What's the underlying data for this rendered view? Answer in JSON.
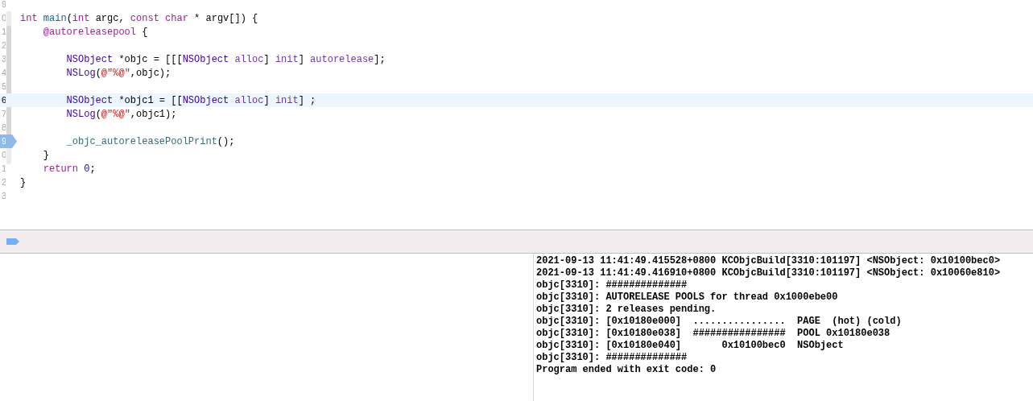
{
  "editor": {
    "lines": [
      {
        "number": "9",
        "current": false,
        "breakpoint": false
      },
      {
        "number": "0",
        "current": false,
        "breakpoint": false,
        "tokens": [
          {
            "kind": "keyword",
            "text": "int "
          },
          {
            "kind": "function",
            "text": "main"
          },
          {
            "kind": "plain",
            "text": "("
          },
          {
            "kind": "keyword",
            "text": "int"
          },
          {
            "kind": "plain",
            "text": " argc, "
          },
          {
            "kind": "keyword",
            "text": "const char"
          },
          {
            "kind": "plain",
            "text": " * argv[]) {"
          }
        ],
        "children": [
          {
            "number": "1",
            "current": false,
            "breakpoint": false,
            "tokens": [
              {
                "kind": "keyword",
                "text": "@autoreleasepool"
              },
              {
                "kind": "plain",
                "text": " {"
              }
            ],
            "children": [
              {
                "number": "2",
                "current": false,
                "breakpoint": false
              },
              {
                "number": "3",
                "current": false,
                "breakpoint": false,
                "tokens": [
                  {
                    "kind": "class",
                    "text": "NSObject"
                  },
                  {
                    "kind": "plain",
                    "text": " *objc = [[["
                  },
                  {
                    "kind": "class",
                    "text": "NSObject"
                  },
                  {
                    "kind": "method",
                    "text": " alloc"
                  },
                  {
                    "kind": "plain",
                    "text": "] "
                  },
                  {
                    "kind": "method",
                    "text": "init"
                  },
                  {
                    "kind": "plain",
                    "text": "] "
                  },
                  {
                    "kind": "method",
                    "text": "autorelease"
                  },
                  {
                    "kind": "plain",
                    "text": "];"
                  }
                ]
              },
              {
                "number": "4",
                "current": false,
                "breakpoint": false,
                "tokens": [
                  {
                    "kind": "class",
                    "text": "NSLog"
                  },
                  {
                    "kind": "plain",
                    "text": "("
                  },
                  {
                    "kind": "string",
                    "text": "@\"%@\""
                  },
                  {
                    "kind": "plain",
                    "text": ",objc);"
                  }
                ]
              },
              {
                "number": "5",
                "current": false,
                "breakpoint": false
              },
              {
                "number": "6",
                "current": true,
                "breakpoint": false,
                "tokens": [
                  {
                    "kind": "class",
                    "text": "NSObject"
                  },
                  {
                    "kind": "plain",
                    "text": " *objc1 = [["
                  },
                  {
                    "kind": "class",
                    "text": "NSObject"
                  },
                  {
                    "kind": "method",
                    "text": " alloc"
                  },
                  {
                    "kind": "plain",
                    "text": "] "
                  },
                  {
                    "kind": "method",
                    "text": "init"
                  },
                  {
                    "kind": "plain",
                    "text": "] ;"
                  }
                ]
              },
              {
                "number": "7",
                "current": false,
                "breakpoint": false,
                "tokens": [
                  {
                    "kind": "class",
                    "text": "NSLog"
                  },
                  {
                    "kind": "plain",
                    "text": "("
                  },
                  {
                    "kind": "string",
                    "text": "@\"%@\""
                  },
                  {
                    "kind": "plain",
                    "text": ",objc1);"
                  }
                ]
              },
              {
                "number": "8",
                "current": false,
                "breakpoint": false
              },
              {
                "number": "9",
                "current": false,
                "breakpoint": true,
                "tokens": [
                  {
                    "kind": "call",
                    "text": "_objc_autoreleasePoolPrint"
                  },
                  {
                    "kind": "plain",
                    "text": "();"
                  }
                ]
              }
            ]
          },
          {
            "number": "0",
            "current": false,
            "breakpoint": false,
            "tokens": [
              {
                "kind": "plain",
                "text": "}"
              }
            ]
          },
          {
            "number": "1",
            "current": false,
            "breakpoint": false,
            "tokens": [
              {
                "kind": "keyword",
                "text": "return "
              },
              {
                "kind": "number",
                "text": "0"
              },
              {
                "kind": "plain",
                "text": ";"
              }
            ]
          }
        ]
      },
      {
        "number": "2",
        "current": false,
        "breakpoint": false,
        "tokens": [
          {
            "kind": "plain",
            "text": "}"
          }
        ]
      },
      {
        "number": "3",
        "current": false,
        "breakpoint": false
      }
    ]
  },
  "console": {
    "lines": [
      "2021-09-13 11:41:49.415528+0800 KCObjcBuild[3310:101197] <NSObject: 0x10100bec0>",
      "2021-09-13 11:41:49.416910+0800 KCObjcBuild[3310:101197] <NSObject: 0x10060e810>",
      "objc[3310]: ##############",
      "objc[3310]: AUTORELEASE POOLS for thread 0x1000ebe00",
      "objc[3310]: 2 releases pending.",
      "objc[3310]: [0x10180e000]  ................  PAGE  (hot) (cold)",
      "objc[3310]: [0x10180e038]  ################  POOL 0x10180e038",
      "objc[3310]: [0x10180e040]       0x10100bec0  NSObject",
      "objc[3310]: ##############",
      "Program ended with exit code: 0"
    ]
  }
}
